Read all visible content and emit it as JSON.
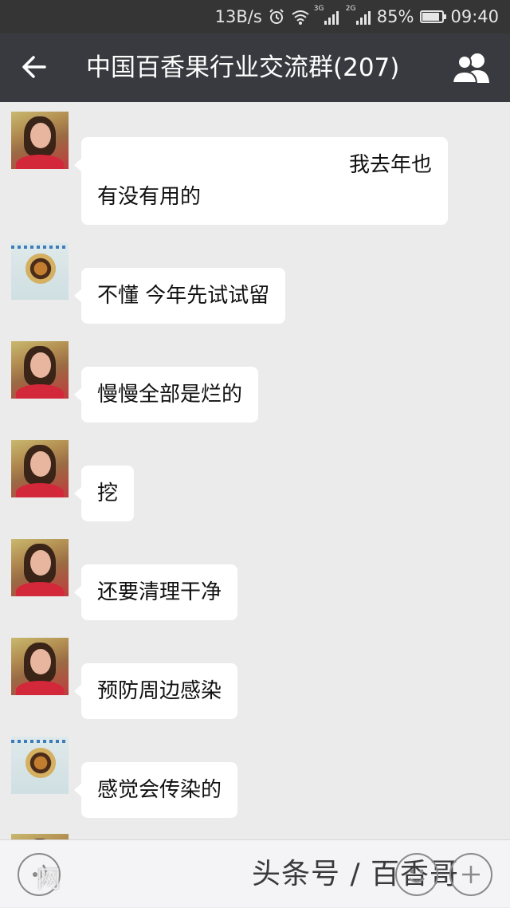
{
  "status_bar": {
    "net_speed": "13B/s",
    "sim1_type": "3G",
    "sim2_type": "2G",
    "battery": "85%",
    "battery_level": 0.85,
    "time": "09:40"
  },
  "header": {
    "title": "中国百香果行业交流群(207)"
  },
  "messages": [
    {
      "avatar": "woman-avatar",
      "lines": [
        "我去年也",
        "有没有用的"
      ]
    },
    {
      "avatar": "dish-avatar",
      "lines": [
        "不懂  今年先试试留"
      ]
    },
    {
      "avatar": "woman-avatar",
      "lines": [
        "慢慢全部是烂的"
      ]
    },
    {
      "avatar": "woman-avatar",
      "lines": [
        "挖"
      ]
    },
    {
      "avatar": "woman-avatar",
      "lines": [
        "还要清理干净"
      ]
    },
    {
      "avatar": "woman-avatar",
      "lines": [
        "预防周边感染"
      ]
    },
    {
      "avatar": "dish-avatar",
      "lines": [
        "感觉会传染的"
      ]
    }
  ],
  "input_bar": {
    "watermark": "头条号 / 百香哥",
    "left_watermark": "网"
  },
  "colors": {
    "status_bg": "#353535",
    "header_bg": "#393a3f",
    "chat_bg": "#ebebeb",
    "bubble_bg": "#ffffff"
  },
  "icons": [
    "back-arrow-icon",
    "group-members-icon",
    "alarm-icon",
    "wifi-icon",
    "signal-icon",
    "battery-icon",
    "voice-icon",
    "emoji-icon",
    "plus-icon"
  ]
}
